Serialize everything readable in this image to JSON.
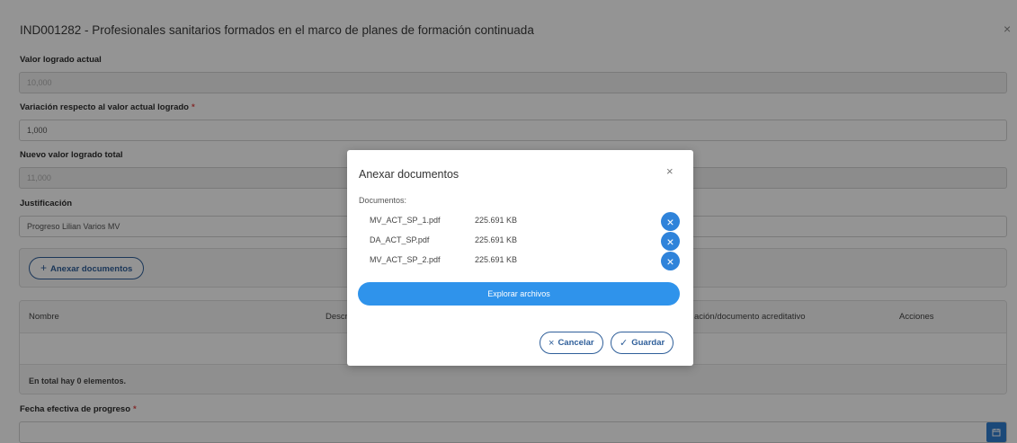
{
  "page": {
    "title": "IND001282 - Profesionales sanitarios formados en el marco de planes de formación continuada",
    "close_icon": "×",
    "fields": {
      "valor_actual": {
        "label": "Valor logrado actual",
        "value": "10,000"
      },
      "variacion": {
        "label": "Variación respecto al valor actual logrado",
        "required": "*",
        "value": "1,000"
      },
      "nuevo_valor": {
        "label": "Nuevo valor logrado total",
        "value": "11,000"
      },
      "justificacion": {
        "label": "Justificación",
        "value": "Progreso Lilian Varios MV"
      },
      "fecha": {
        "label": "Fecha efectiva de progreso",
        "required": "*",
        "value": ""
      }
    },
    "anexar_button": {
      "icon": "+",
      "label": "Anexar documentos"
    },
    "table": {
      "columns": [
        "Nombre",
        "Descrip",
        "ación/documento acreditativo",
        "Acciones"
      ],
      "footer": "En total hay 0 elementos."
    }
  },
  "modal": {
    "title": "Anexar documentos",
    "close_icon": "×",
    "documents_label": "Documentos:",
    "documents": [
      {
        "name": "MV_ACT_SP_1.pdf",
        "size": "225.691 KB"
      },
      {
        "name": "DA_ACT_SP.pdf",
        "size": "225.691 KB"
      },
      {
        "name": "MV_ACT_SP_2.pdf",
        "size": "225.691 KB"
      }
    ],
    "remove_icon": "×",
    "explore_label": "Explorar archivos",
    "cancel": {
      "icon": "×",
      "label": "Cancelar"
    },
    "save": {
      "icon": "✓",
      "label": "Guardar"
    }
  },
  "colors": {
    "primary": "#2f83da",
    "explore": "#2f93eb",
    "outline": "#2f5f9a",
    "required": "#e24a4a",
    "overlay": "rgba(0,0,0,0.42)"
  },
  "icons": [
    "close-icon",
    "plus-icon",
    "calendar-icon",
    "remove-icon",
    "check-icon"
  ]
}
